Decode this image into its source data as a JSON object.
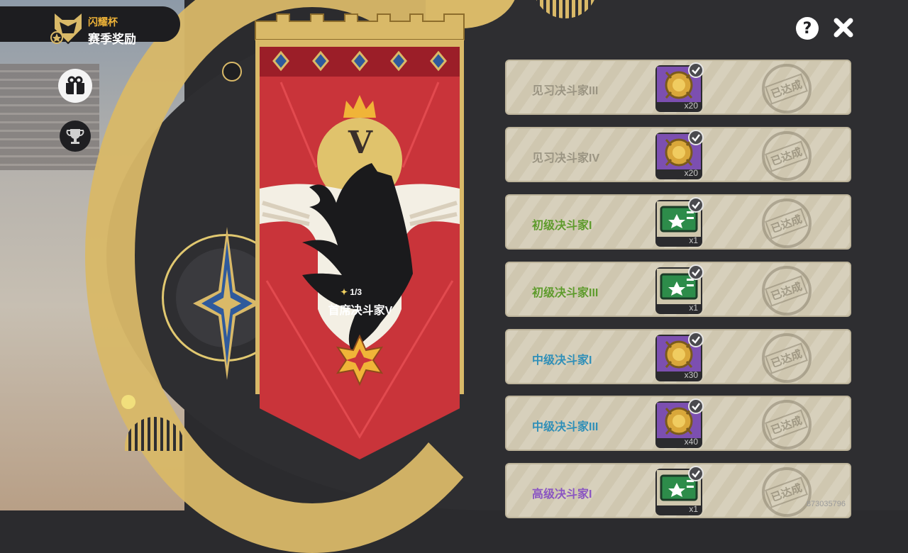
{
  "header": {
    "subtitle": "闪耀杯",
    "title": "赛季奖励"
  },
  "topbar": {
    "help_label": "?"
  },
  "banner": {
    "roman": "V",
    "progress": "1/3",
    "rank_name": "首席决斗家V"
  },
  "rewards": [
    {
      "name": "见习决斗家III",
      "color": "#9a9482",
      "qty": "x20",
      "icon": "coin-icon",
      "status": "已达成"
    },
    {
      "name": "见习决斗家IV",
      "color": "#9a9482",
      "qty": "x20",
      "icon": "coin-icon",
      "status": "已达成"
    },
    {
      "name": "初级决斗家I",
      "color": "#5e9b2c",
      "qty": "x1",
      "icon": "ticket-icon",
      "status": "已达成"
    },
    {
      "name": "初级决斗家III",
      "color": "#5e9b2c",
      "qty": "x1",
      "icon": "ticket-icon",
      "status": "已达成"
    },
    {
      "name": "中级决斗家I",
      "color": "#2f8fb8",
      "qty": "x30",
      "icon": "coin-icon",
      "status": "已达成"
    },
    {
      "name": "中级决斗家III",
      "color": "#2f8fb8",
      "qty": "x40",
      "icon": "coin-icon",
      "status": "已达成"
    },
    {
      "name": "高级决斗家I",
      "color": "#8a55c2",
      "qty": "x1",
      "icon": "ticket-icon",
      "status": "已达成"
    }
  ],
  "footer": {
    "uid": "873035796"
  },
  "colors": {
    "gold": "#d9b968",
    "banner_red": "#c9343a",
    "dark": "#2e2e31"
  }
}
